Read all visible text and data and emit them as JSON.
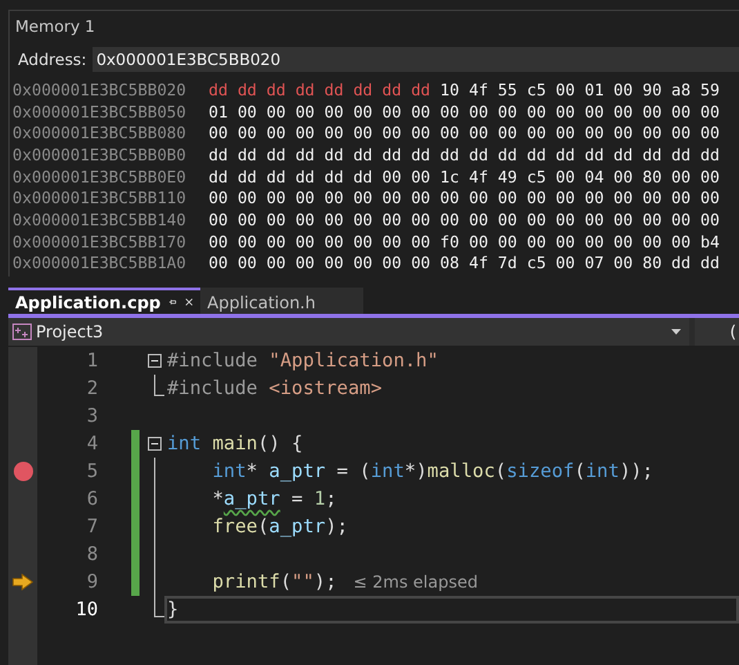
{
  "memory_window": {
    "title": "Memory 1",
    "address_label": "Address:",
    "address_value": "0x000001E3BC5BB020",
    "rows": [
      {
        "address": "0x000001E3BC5BB020",
        "changed_bytes": "dd dd dd dd dd dd dd dd",
        "bytes": "10 4f 55 c5 00 01 00 90 a8 59"
      },
      {
        "address": "0x000001E3BC5BB050",
        "bytes": "01 00 00 00 00 00 00 00 00 00 00 00 00 00 00 00 00 00"
      },
      {
        "address": "0x000001E3BC5BB080",
        "bytes": "00 00 00 00 00 00 00 00 00 00 00 00 00 00 00 00 00 00"
      },
      {
        "address": "0x000001E3BC5BB0B0",
        "bytes": "dd dd dd dd dd dd dd dd dd dd dd dd dd dd dd dd dd dd"
      },
      {
        "address": "0x000001E3BC5BB0E0",
        "bytes": "dd dd dd dd dd dd 00 00 1c 4f 49 c5 00 04 00 80 00 00"
      },
      {
        "address": "0x000001E3BC5BB110",
        "bytes": "00 00 00 00 00 00 00 00 00 00 00 00 00 00 00 00 00 00"
      },
      {
        "address": "0x000001E3BC5BB140",
        "bytes": "00 00 00 00 00 00 00 00 00 00 00 00 00 00 00 00 00 00"
      },
      {
        "address": "0x000001E3BC5BB170",
        "bytes": "00 00 00 00 00 00 00 00 f0 00 00 00 00 00 00 00 00 b4"
      },
      {
        "address": "0x000001E3BC5BB1A0",
        "bytes": "00 00 00 00 00 00 00 00 08 4f 7d c5 00 07 00 80 dd dd"
      }
    ]
  },
  "editor_tabs": [
    {
      "label": "Application.cpp",
      "selected": true
    },
    {
      "label": "Application.h",
      "selected": false
    }
  ],
  "navigation_bar": {
    "project": "Project3",
    "scope": "("
  },
  "lines": [
    {
      "number": "1",
      "fold_start": true,
      "tokens": [
        {
          "t": "#include",
          "kind": "pre"
        },
        {
          "t": " \"Application.h\"",
          "kind": "str"
        }
      ]
    },
    {
      "number": "2",
      "fold_end": true,
      "tokens": [
        {
          "t": "#include",
          "kind": "pre"
        },
        {
          "t": " <iostream>",
          "kind": "str"
        }
      ]
    },
    {
      "number": "3"
    },
    {
      "number": "4",
      "fold_start": true,
      "changed": true,
      "tokens": [
        {
          "t": "int",
          "kind": "kw"
        },
        {
          "t": " main",
          "kind": "fn"
        },
        {
          "t": "() {",
          "kind": "punc"
        }
      ]
    },
    {
      "number": "5",
      "fold_inside": true,
      "changed": true,
      "breakpoint": true,
      "tokens": [
        {
          "t": "    int",
          "kind": "kw"
        },
        {
          "t": "*",
          "kind": "punc"
        },
        {
          "t": " a_ptr",
          "kind": "var"
        },
        {
          "t": " = (",
          "kind": "punc"
        },
        {
          "t": "int",
          "kind": "kw"
        },
        {
          "t": "*)",
          "kind": "punc"
        },
        {
          "t": "malloc",
          "kind": "fn"
        },
        {
          "t": "(",
          "kind": "punc"
        },
        {
          "t": "sizeof",
          "kind": "kw"
        },
        {
          "t": "(",
          "kind": "punc"
        },
        {
          "t": "int",
          "kind": "kw"
        },
        {
          "t": "));",
          "kind": "punc"
        }
      ]
    },
    {
      "number": "6",
      "fold_inside": true,
      "changed": true,
      "tokens": [
        {
          "t": "    *",
          "kind": "punc"
        },
        {
          "t": "a_ptr",
          "kind": "var",
          "warning": true
        },
        {
          "t": " = ",
          "kind": "punc"
        },
        {
          "t": "1",
          "kind": "num"
        },
        {
          "t": ";",
          "kind": "punc"
        }
      ]
    },
    {
      "number": "7",
      "fold_inside": true,
      "changed": true,
      "tokens": [
        {
          "t": "    free",
          "kind": "fn"
        },
        {
          "t": "(",
          "kind": "punc"
        },
        {
          "t": "a_ptr",
          "kind": "var"
        },
        {
          "t": ");",
          "kind": "punc"
        }
      ]
    },
    {
      "number": "8",
      "fold_inside": true,
      "changed": true
    },
    {
      "number": "9",
      "fold_inside": true,
      "changed": true,
      "current": true,
      "hint": "≤ 2ms elapsed",
      "tokens": [
        {
          "t": "    printf",
          "kind": "fn"
        },
        {
          "t": "(",
          "kind": "punc"
        },
        {
          "t": "\"\"",
          "kind": "str"
        },
        {
          "t": ");",
          "kind": "punc"
        }
      ]
    },
    {
      "number": "10",
      "fold_end": true,
      "caret": true,
      "tokens": [
        {
          "t": "}",
          "kind": "punc"
        }
      ]
    }
  ]
}
